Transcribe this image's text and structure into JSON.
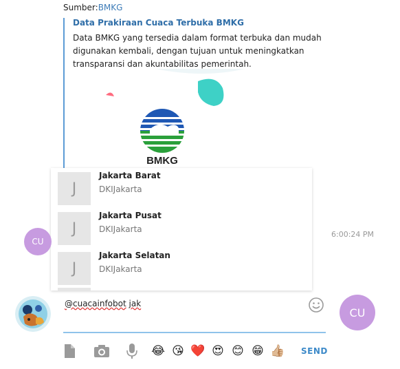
{
  "preview": {
    "source_prefix": "Sumber:",
    "source_link": "BMKG",
    "title": "Data Prakiraan Cuaca Terbuka BMKG",
    "description": "Data BMKG yang tersedia dalam format terbuka dan mudah digunakan kembali, dengan tujuan untuk meningkatkan transparansi dan akuntabilitas pemerintah.",
    "logo_text": "BMKG"
  },
  "suggestions": [
    {
      "initial": "J",
      "name": "Jakarta Barat",
      "region": "DKIJakarta"
    },
    {
      "initial": "J",
      "name": "Jakarta Pusat",
      "region": "DKIJakarta"
    },
    {
      "initial": "J",
      "name": "Jakarta Selatan",
      "region": "DKIJakarta"
    }
  ],
  "message": {
    "avatar_initials": "CU",
    "timestamp": "6:00:24 PM"
  },
  "composer": {
    "mention": "@cuacainfobot",
    "command": "jak",
    "user_avatar_initials": "CU",
    "send_label": "SEND"
  },
  "toolbar": {
    "icons": [
      "file-icon",
      "camera-icon",
      "microphone-icon"
    ],
    "emojis": [
      "😂",
      "😘",
      "❤️",
      "😍",
      "😊",
      "😁",
      "👍🏼"
    ]
  },
  "colors": {
    "accent": "#3d8ac9",
    "avatar": "#c79be0",
    "link": "#2f6ea8"
  }
}
